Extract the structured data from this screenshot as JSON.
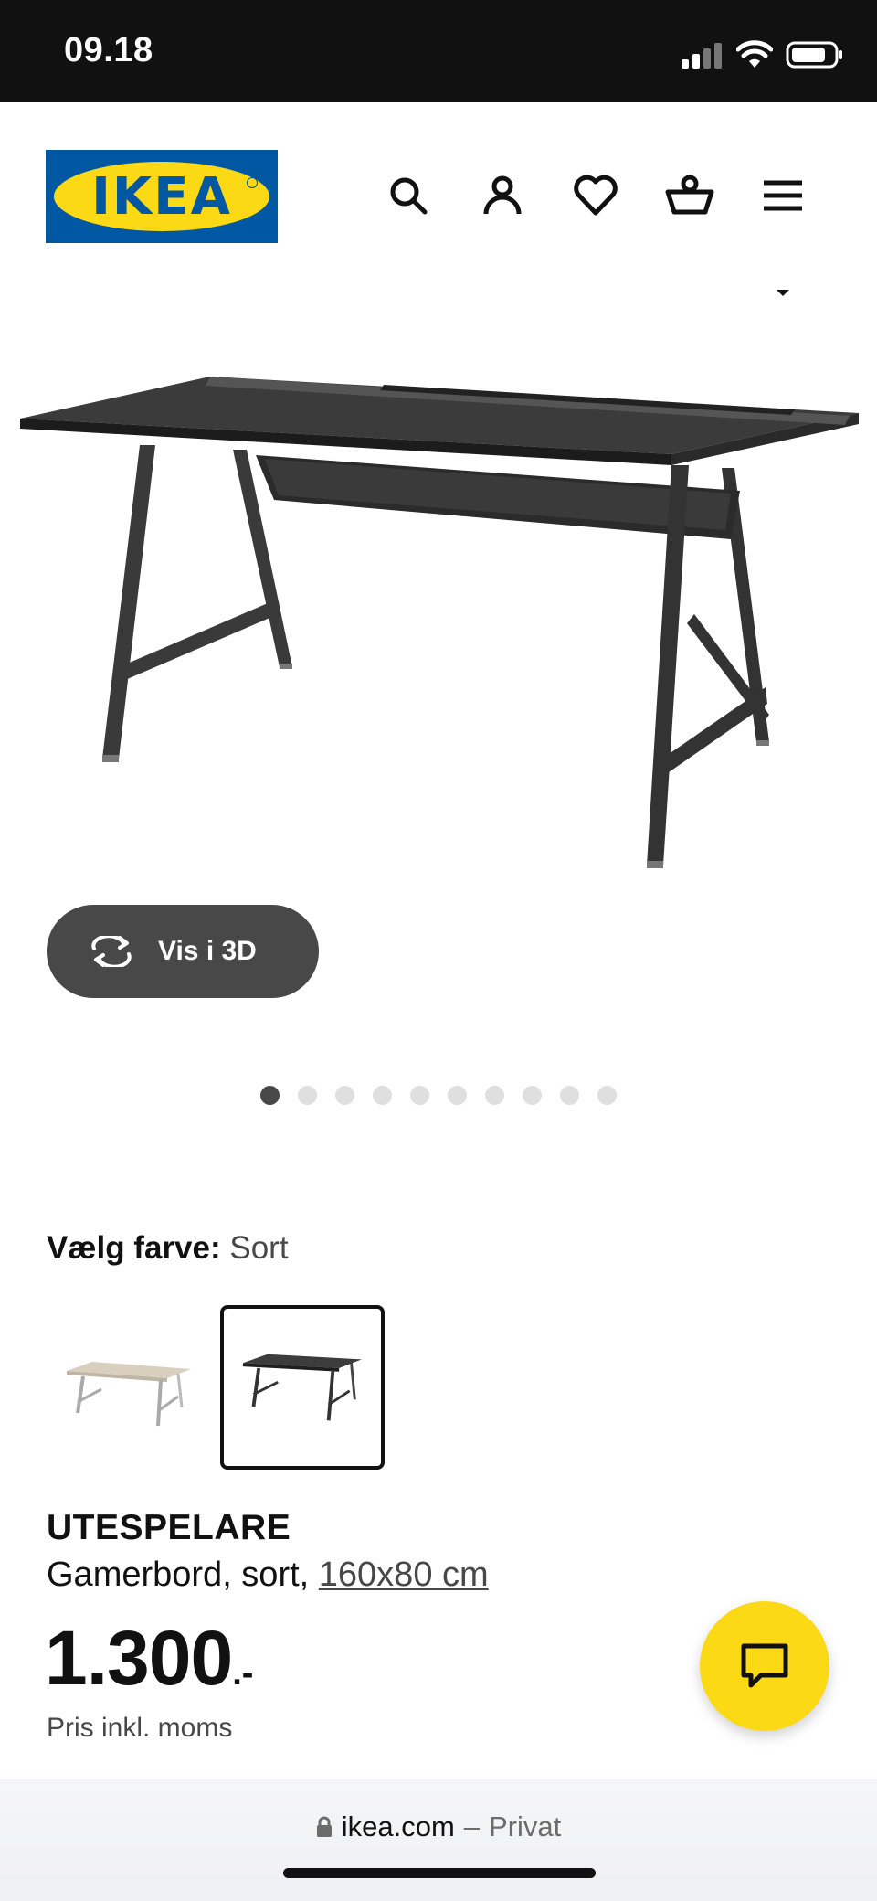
{
  "status_bar": {
    "time": "09.18"
  },
  "header": {
    "logo_text": "IKEA",
    "icons": [
      "search-icon",
      "account-icon",
      "favourites-icon",
      "basket-icon",
      "menu-icon"
    ]
  },
  "gallery": {
    "view_3d_label": "Vis i 3D",
    "image_count": 10,
    "active_index": 0
  },
  "color_picker": {
    "label": "Vælg farve:",
    "selected_value": "Sort",
    "options": [
      "white-stained-oak-swatch",
      "black-swatch"
    ],
    "selected_index": 1
  },
  "product": {
    "name": "UTESPELARE",
    "description": "Gamerbord, sort,",
    "size": "160x80 cm",
    "price_integer": "1.300",
    "price_decimals": ".-",
    "price_note": "Pris inkl. moms"
  },
  "browser": {
    "domain": "ikea.com",
    "separator": "–",
    "mode": "Privat"
  },
  "colors": {
    "ikea_blue": "#0058a3",
    "ikea_yellow": "#fbd914",
    "dark": "#111111",
    "grey": "#484848"
  }
}
